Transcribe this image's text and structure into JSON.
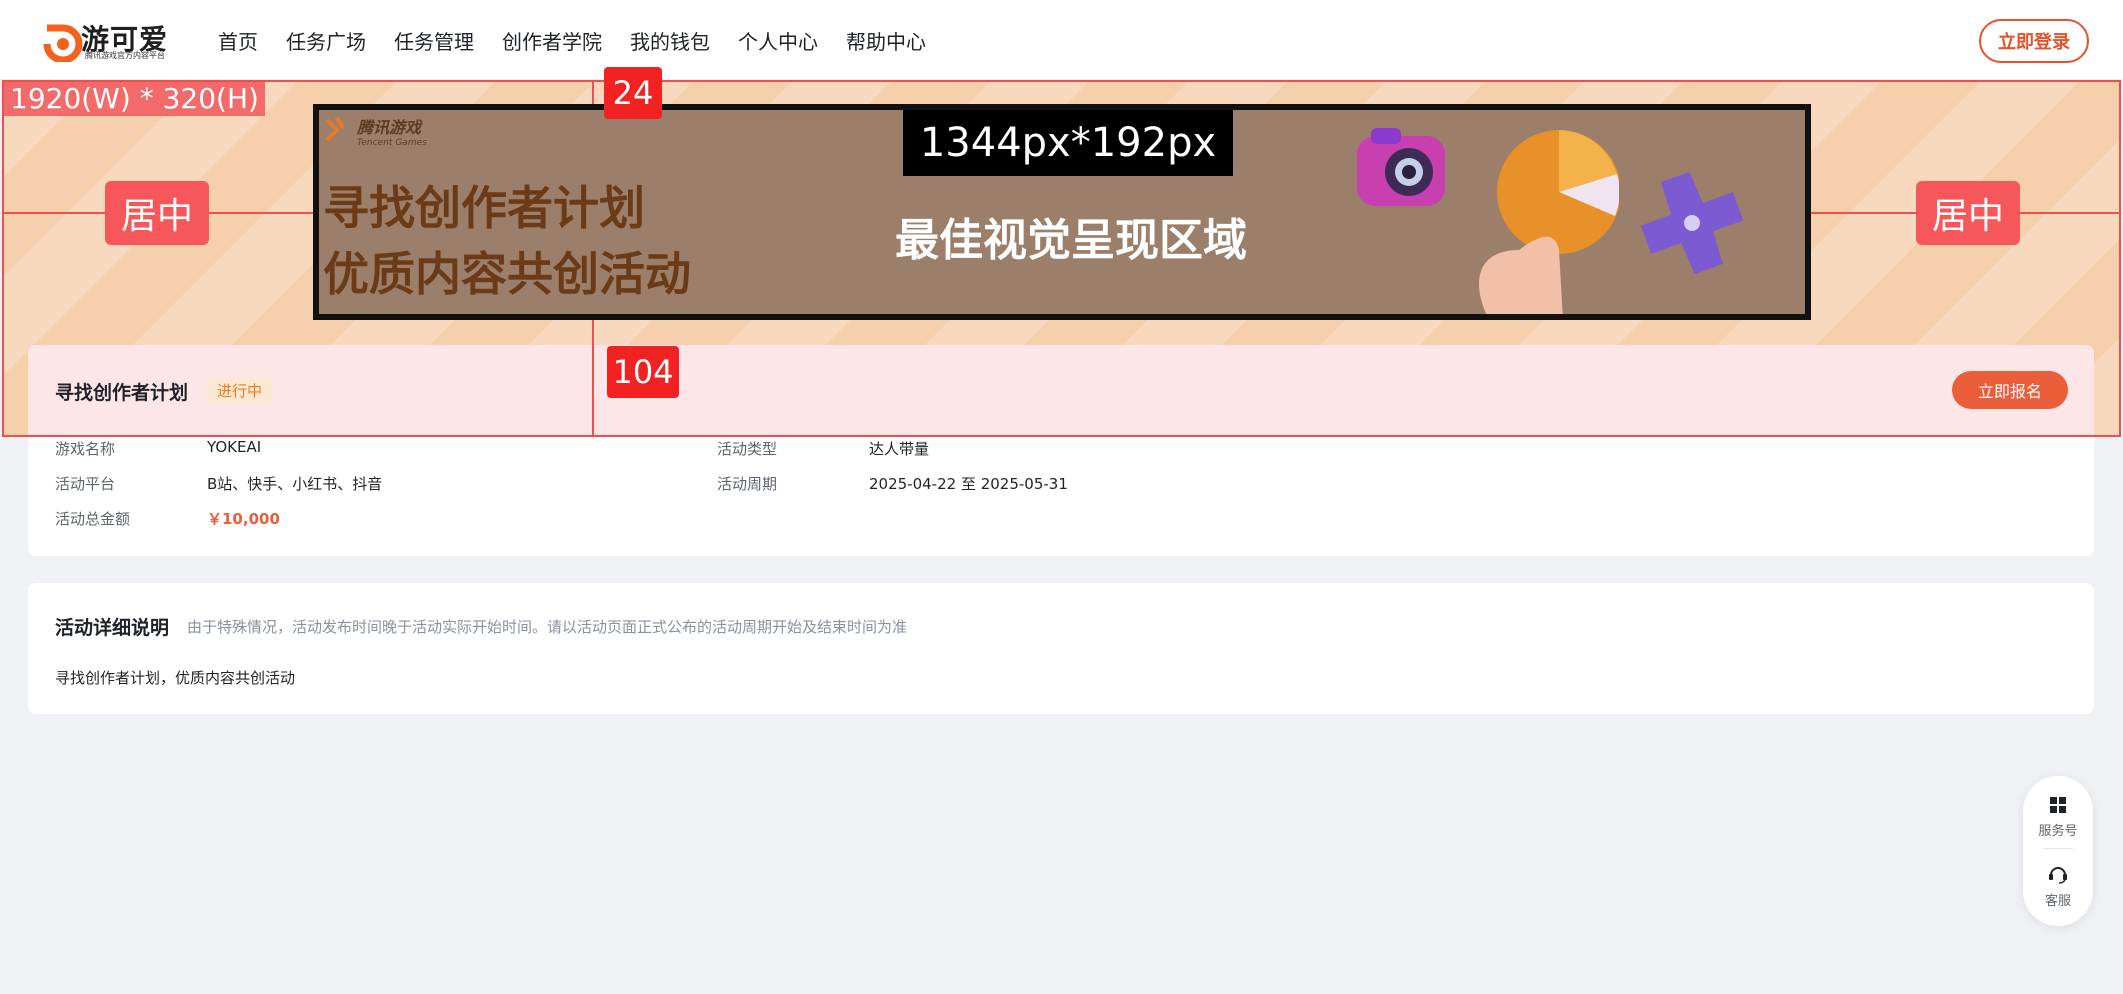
{
  "header": {
    "logo_title": "游可爱",
    "logo_subtitle": "腾讯游戏官方内容平台",
    "nav": [
      "首页",
      "任务广场",
      "任务管理",
      "创作者学院",
      "我的钱包",
      "个人中心",
      "帮助中心"
    ],
    "login_label": "立即登录"
  },
  "banner": {
    "size_label": "1920(W) * 320(H)",
    "safe_area_size": "1344px*192px",
    "safe_area_text": "最佳视觉呈现区域",
    "brand_cn": "腾讯游戏",
    "brand_en": "Tencent Games",
    "headline_1": "寻找创作者计划",
    "headline_2": "优质内容共创活动",
    "center_left": "居中",
    "center_right": "居中",
    "top_gap": "24",
    "bottom_gap": "104"
  },
  "activity": {
    "title": "寻找创作者计划",
    "status": "进行中",
    "signup_label": "立即报名",
    "fields": [
      {
        "label": "游戏名称",
        "value": "YOKEAI"
      },
      {
        "label": "活动类型",
        "value": "达人带量"
      },
      {
        "label": "活动平台",
        "value": "B站、快手、小红书、抖音"
      },
      {
        "label": "活动周期",
        "value": "2025-04-22 至 2025-05-31"
      },
      {
        "label": "活动总金额",
        "value": "￥10,000"
      }
    ]
  },
  "detail": {
    "title": "活动详细说明",
    "note": "由于特殊情况，活动发布时间晚于活动实际开始时间。请以活动页面正式公布的活动周期开始及结束时间为准",
    "body": "寻找创作者计划，优质内容共创活动"
  },
  "float_panel": {
    "service_label": "服务号",
    "support_label": "客服"
  },
  "colors": {
    "accent": "#ea5e3a",
    "annotation_red": "#f04f4f",
    "status_orange": "#f07a1f",
    "info_header_bg": "#fde6e8"
  }
}
